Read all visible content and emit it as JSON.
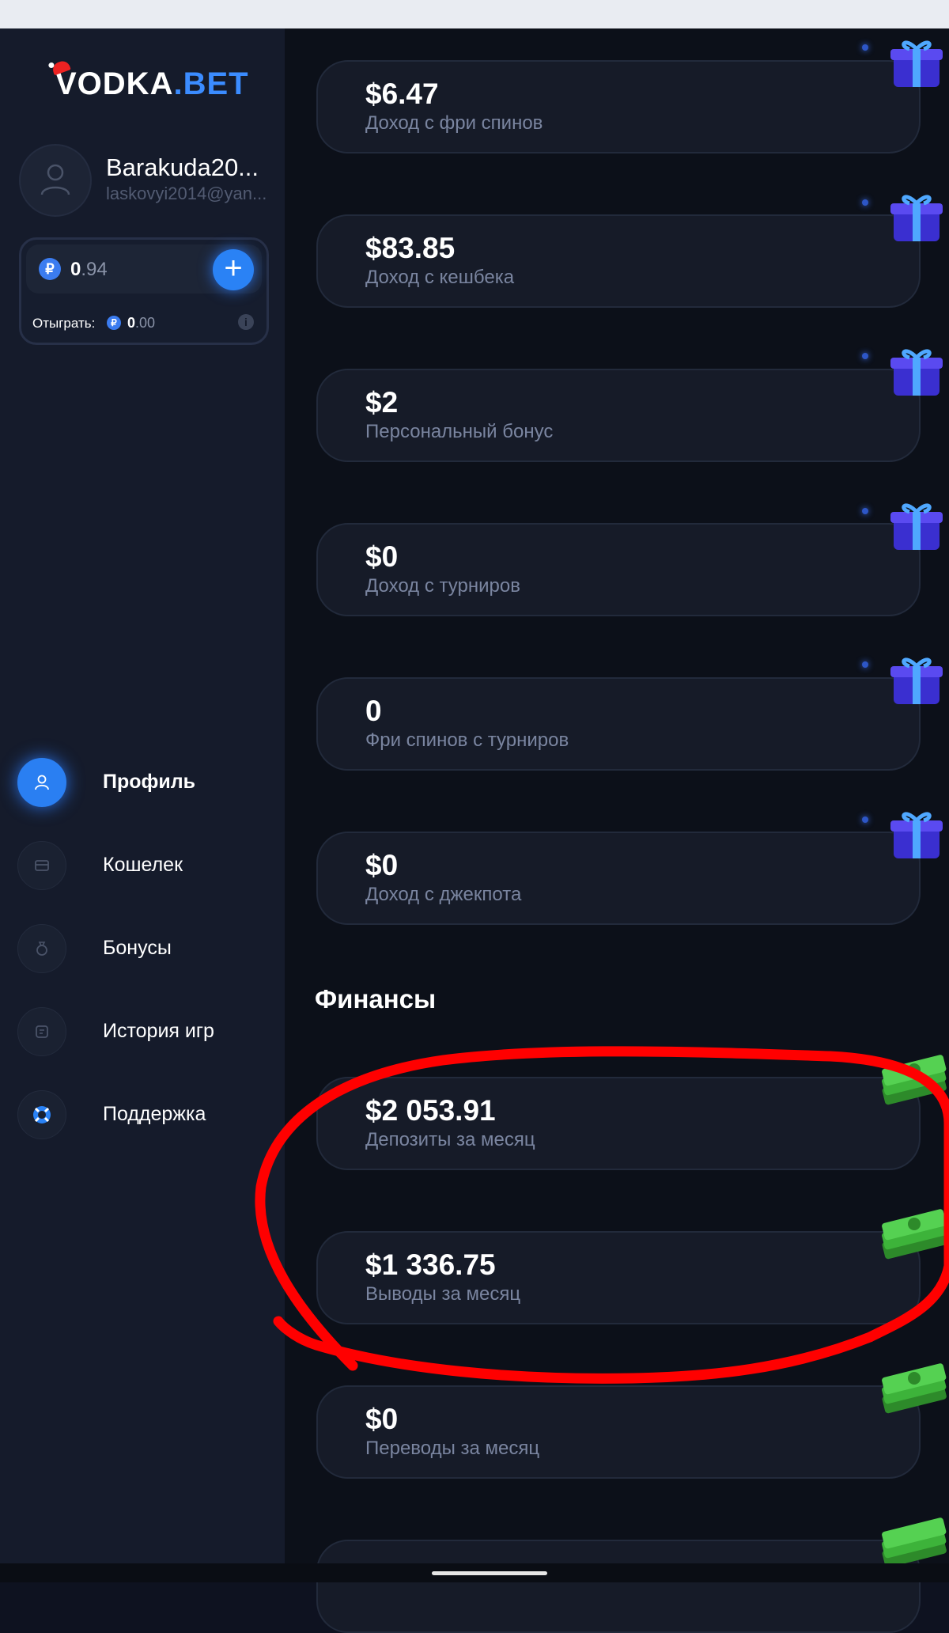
{
  "brand": {
    "logo_text": "VODKA",
    "logo_suffix": ".BET"
  },
  "user": {
    "name": "Barakuda20...",
    "email": "laskovyi2014@yan..."
  },
  "balance": {
    "int": "0",
    "dec": ".94",
    "currency_icon": "₽",
    "add_label": "+",
    "wager_label": "Отыграть:",
    "wager_int": "0",
    "wager_dec": ".00",
    "info_icon": "i"
  },
  "nav": [
    {
      "label": "Профиль",
      "icon": "user-icon",
      "active": true
    },
    {
      "label": "Кошелек",
      "icon": "wallet-icon",
      "active": false
    },
    {
      "label": "Бонусы",
      "icon": "money-bag-icon",
      "active": false
    },
    {
      "label": "История игр",
      "icon": "history-icon",
      "active": false
    },
    {
      "label": "Поддержка",
      "icon": "lifebuoy-icon",
      "active": false
    }
  ],
  "bonus_cards": [
    {
      "value": "$6.47",
      "label": "Доход с фри спинов"
    },
    {
      "value": "$83.85",
      "label": "Доход с кешбека"
    },
    {
      "value": "$2",
      "label": "Персональный бонус"
    },
    {
      "value": "$0",
      "label": "Доход с турниров"
    },
    {
      "value": "0",
      "label": "Фри спинов с турниров"
    },
    {
      "value": "$0",
      "label": "Доход с джекпота"
    }
  ],
  "finance": {
    "title": "Финансы",
    "cards": [
      {
        "value": "$2 053.91",
        "label": "Депозиты за месяц"
      },
      {
        "value": "$1 336.75",
        "label": "Выводы за месяц"
      },
      {
        "value": "$0",
        "label": "Переводы за месяц"
      }
    ]
  },
  "colors": {
    "accent": "#2a82f5",
    "background": "#0c1019",
    "sidebar": "#151b2b",
    "card": "#161b28",
    "annotation": "#ff0000"
  }
}
